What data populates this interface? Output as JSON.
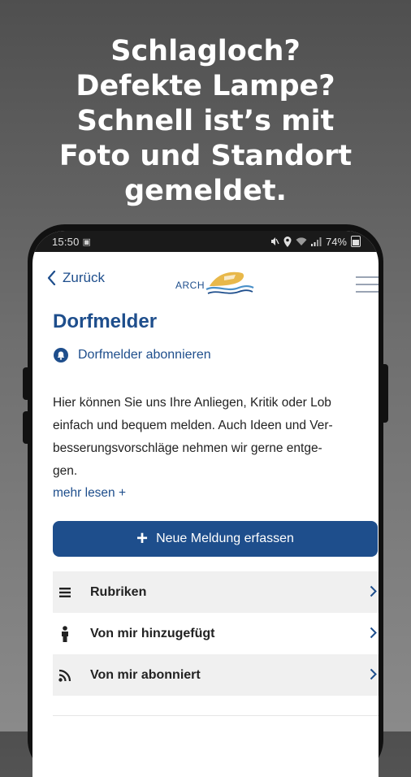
{
  "headline": {
    "lines": [
      "Schlagloch?",
      "Defekte Lampe?",
      "Schnell ist’s mit",
      "Foto und Standort",
      "gemeldet."
    ]
  },
  "status_bar": {
    "time": "15:50",
    "battery": "74%"
  },
  "nav": {
    "back_label": "Zurück",
    "logo_text": "ARCH"
  },
  "page": {
    "title": "Dorfmelder",
    "subscribe_label": "Dorfmelder abonnieren",
    "description_lines": [
      "Hier können Sie uns Ihre Anliegen, Kritik oder Lob",
      "einfach und bequem melden. Auch Ideen und Ver-",
      "besserungsvorschläge nehmen wir gerne entge-",
      "gen."
    ],
    "more_label": "mehr lesen +",
    "new_report_button": "Neue Meldung erfassen"
  },
  "menu": [
    {
      "label": "Rubriken",
      "icon": "list-icon"
    },
    {
      "label": "Von mir hinzugefügt",
      "icon": "person-icon"
    },
    {
      "label": "Von mir abonniert",
      "icon": "rss-icon"
    }
  ],
  "colors": {
    "accent": "#1e4e8c",
    "logo_gold": "#e8b84a",
    "logo_wave": "#4a90c8"
  }
}
